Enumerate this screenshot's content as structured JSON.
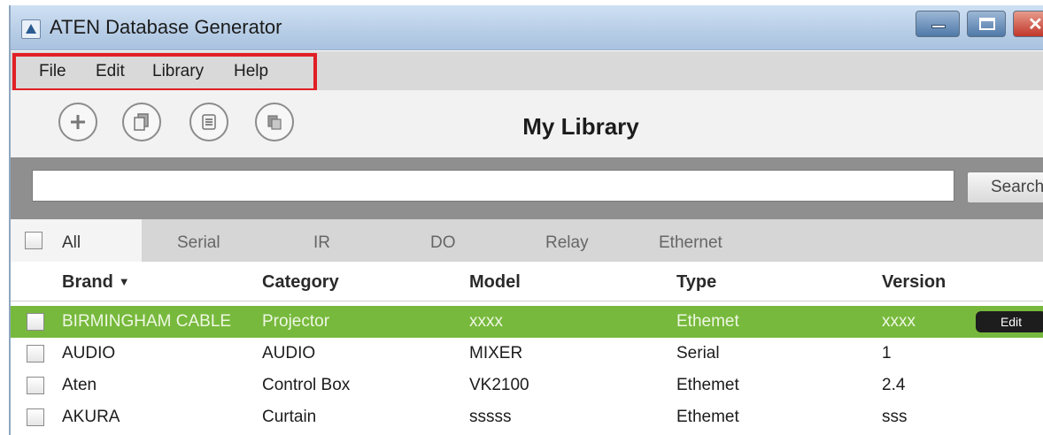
{
  "window": {
    "title": "ATEN Database Generator"
  },
  "menu": {
    "file": "File",
    "edit": "Edit",
    "library": "Library",
    "help": "Help"
  },
  "toolbar": {
    "title": "My Library",
    "buttons": [
      "add-icon",
      "copy-icon",
      "list-icon",
      "export-icon"
    ]
  },
  "search": {
    "value": "",
    "button_label": "Search"
  },
  "tabs": {
    "all": "All",
    "serial": "Serial",
    "ir": "IR",
    "do": "DO",
    "relay": "Relay",
    "ethernet": "Ethernet"
  },
  "table": {
    "headers": {
      "brand": "Brand",
      "category": "Category",
      "model": "Model",
      "type": "Type",
      "version": "Version"
    },
    "sort_indicator": "▼",
    "edit_label": "Edit",
    "rows": [
      {
        "brand": "BIRMINGHAM CABLE",
        "category": "Projector",
        "model": "xxxx",
        "type": "Ethemet",
        "version": "xxxx",
        "selected": true
      },
      {
        "brand": "AUDIO",
        "category": "AUDIO",
        "model": "MIXER",
        "type": "Serial",
        "version": "1",
        "selected": false
      },
      {
        "brand": "Aten",
        "category": "Control Box",
        "model": "VK2100",
        "type": "Ethemet",
        "version": "2.4",
        "selected": false
      },
      {
        "brand": "AKURA",
        "category": "Curtain",
        "model": "sssss",
        "type": "Ethemet",
        "version": "sss",
        "selected": false
      }
    ]
  },
  "colors": {
    "selected_row": "#77b93c",
    "highlight_box": "#e01f26",
    "titlebar": "#b7cde6"
  }
}
